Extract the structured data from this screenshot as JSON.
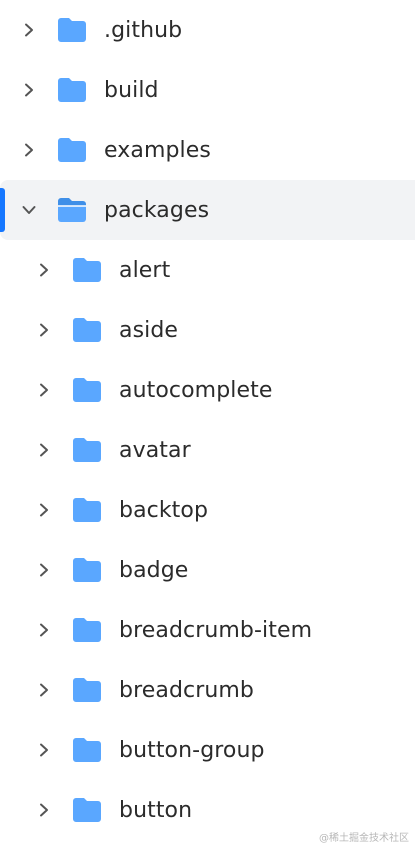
{
  "colors": {
    "folder": "#5aa7ff",
    "folder_dark": "#3f8fe8",
    "chevron": "#555555",
    "selected_bg": "#f2f3f5",
    "accent": "#1677ff"
  },
  "tree": {
    "top": [
      {
        "label": ".github",
        "icon": "folder-icon",
        "expanded": false
      },
      {
        "label": "build",
        "icon": "folder-icon",
        "expanded": false
      },
      {
        "label": "examples",
        "icon": "folder-icon",
        "expanded": false
      },
      {
        "label": "packages",
        "icon": "folder-open-icon",
        "expanded": true,
        "selected": true
      }
    ],
    "children": [
      {
        "label": "alert"
      },
      {
        "label": "aside"
      },
      {
        "label": "autocomplete"
      },
      {
        "label": "avatar"
      },
      {
        "label": "backtop"
      },
      {
        "label": "badge"
      },
      {
        "label": "breadcrumb-item"
      },
      {
        "label": "breadcrumb"
      },
      {
        "label": "button-group"
      },
      {
        "label": "button"
      }
    ]
  },
  "watermark": "@稀土掘金技术社区"
}
